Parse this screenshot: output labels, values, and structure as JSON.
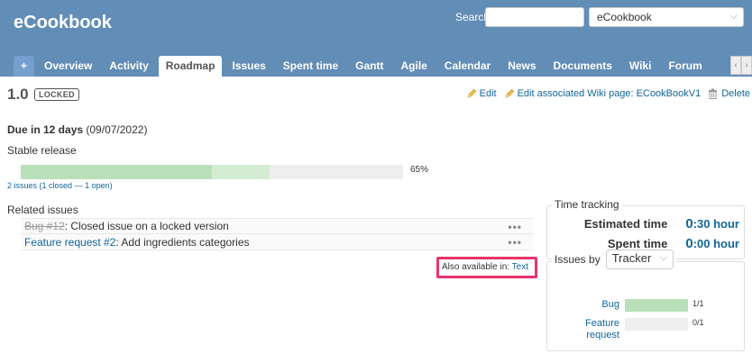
{
  "header": {
    "app_title": "eCookbook",
    "search_label": "Search:",
    "search_value": "",
    "project_select": "eCookbook"
  },
  "tabs": [
    {
      "label": "+"
    },
    {
      "label": "Overview"
    },
    {
      "label": "Activity"
    },
    {
      "label": "Roadmap",
      "selected": true
    },
    {
      "label": "Issues"
    },
    {
      "label": "Spent time"
    },
    {
      "label": "Gantt"
    },
    {
      "label": "Agile"
    },
    {
      "label": "Calendar"
    },
    {
      "label": "News"
    },
    {
      "label": "Documents"
    },
    {
      "label": "Wiki"
    },
    {
      "label": "Forum"
    }
  ],
  "version": {
    "title": "1.0",
    "badge": "LOCKED",
    "actions": {
      "edit": "Edit",
      "edit_wiki": "Edit associated Wiki page: ECookBookV1",
      "delete": "Delete"
    },
    "due_bold": "Due in 12 days",
    "due_date": "(09/07/2022)",
    "description": "Stable release",
    "progress": {
      "closed_percent": 50,
      "done_percent": 65,
      "label": "65%"
    },
    "issue_counts": {
      "total": "2 issues",
      "detail": "(1 closed — 1 open)"
    }
  },
  "related": {
    "title": "Related issues",
    "issues": [
      {
        "tracker": "Bug #12",
        "subject": ": Closed issue on a locked version",
        "closed": true
      },
      {
        "tracker": "Feature request #2",
        "subject": ": Add ingredients categories",
        "closed": false
      }
    ],
    "dots": "•••"
  },
  "also_available": {
    "prefix": "Also available in:",
    "link": "Text"
  },
  "time_tracking": {
    "legend": "Time tracking",
    "estimated_label": "Estimated time",
    "estimated_big": "0",
    "estimated_rest": ":30 hour",
    "spent_label": "Spent time",
    "spent_big": "0",
    "spent_rest": ":00 hour"
  },
  "issues_by": {
    "legend": "Issues by",
    "select": "Tracker",
    "rows": [
      {
        "name": "Bug",
        "fraction": 1.0,
        "count": "1/1"
      },
      {
        "name": "Feature request",
        "fraction": 0.0,
        "count": "0/1"
      }
    ]
  },
  "colors": {
    "header_bg": "#628db6",
    "link": "#169",
    "progress_closed": "#bae0ba",
    "progress_done": "#d3edd3",
    "highlight": "#e8336b"
  }
}
